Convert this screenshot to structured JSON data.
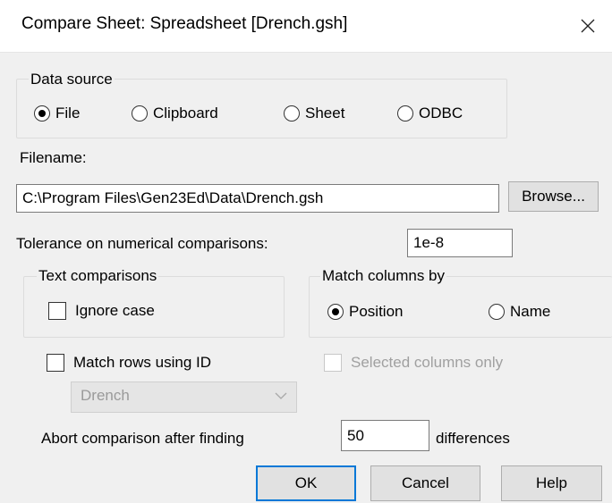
{
  "window": {
    "title": "Compare Sheet: Spreadsheet [Drench.gsh]",
    "close_icon": "close-icon"
  },
  "data_source": {
    "legend": "Data source",
    "options": [
      {
        "label": "File",
        "selected": true
      },
      {
        "label": "Clipboard",
        "selected": false
      },
      {
        "label": "Sheet",
        "selected": false
      },
      {
        "label": "ODBC",
        "selected": false
      }
    ]
  },
  "filename": {
    "label": "Filename:",
    "value": "C:\\Program Files\\Gen23Ed\\Data\\Drench.gsh",
    "browse_label": "Browse..."
  },
  "tolerance": {
    "label": "Tolerance on numerical comparisons:",
    "value": "1e-8"
  },
  "text_comparisons": {
    "legend": "Text comparisons",
    "ignore_case_label": "Ignore case",
    "ignore_case_checked": false
  },
  "match_columns": {
    "legend": "Match columns by",
    "options": [
      {
        "label": "Position",
        "selected": true
      },
      {
        "label": "Name",
        "selected": false
      }
    ]
  },
  "match_rows": {
    "label": "Match rows using ID",
    "checked": false,
    "selected_columns_label": "Selected columns only",
    "selected_columns_checked": false,
    "selected_columns_enabled": false,
    "id_combo_value": "Drench",
    "id_combo_enabled": false
  },
  "abort": {
    "label": "Abort comparison after finding",
    "value": "50",
    "suffix": "differences"
  },
  "buttons": {
    "ok": "OK",
    "cancel": "Cancel",
    "help": "Help"
  },
  "colors": {
    "dialog_background": "#f0f0f0",
    "titlebar_background": "#ffffff",
    "default_button_border": "#0078d7",
    "disabled_text": "#a0a0a0"
  }
}
